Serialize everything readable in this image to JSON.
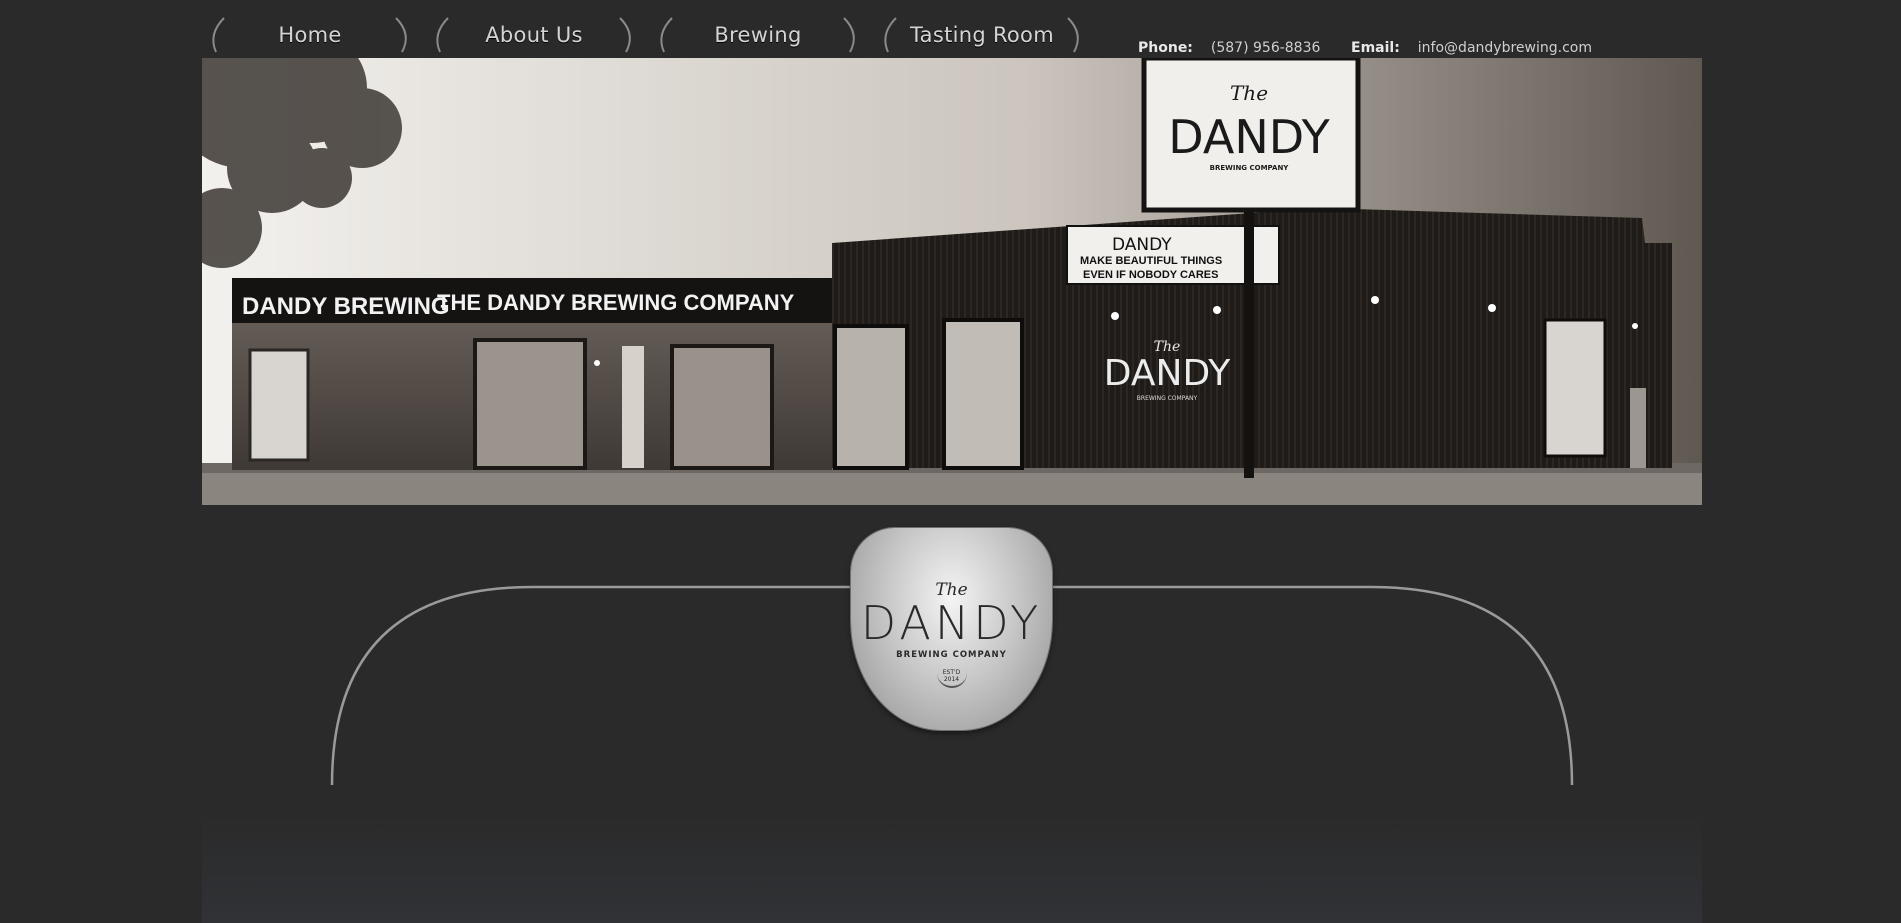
{
  "nav": {
    "items": [
      {
        "label": "Home"
      },
      {
        "label": "About Us"
      },
      {
        "label": "Brewing"
      },
      {
        "label": "Tasting Room"
      }
    ]
  },
  "contact": {
    "phone_label": "Phone:",
    "phone": "(587) 956-8836",
    "email_label": "Email:",
    "email": "info@dandybrewing.com"
  },
  "hero": {
    "sign_the": "The",
    "sign_name": "DANDY",
    "sign_sub": "BREWING COMPANY",
    "building_sign_left": "DANDY BREWING",
    "building_sign_right": "THE DANDY BREWING COMPANY",
    "marquee_name": "DANDY",
    "marquee_line1": "MAKE BEAUTIFUL THINGS",
    "marquee_line2": "EVEN IF NOBODY CARES",
    "wall_the": "The",
    "wall_name": "DANDY",
    "wall_sub": "BREWING COMPANY"
  },
  "badge": {
    "the": "The",
    "name": "DANDY",
    "sub": "BREWING COMPANY",
    "est": "EST'D",
    "year": "2014"
  },
  "colors": {
    "background": "#2a2a2a",
    "panel_line": "#9a9a9a",
    "nav_text": "#d4d4d4"
  }
}
